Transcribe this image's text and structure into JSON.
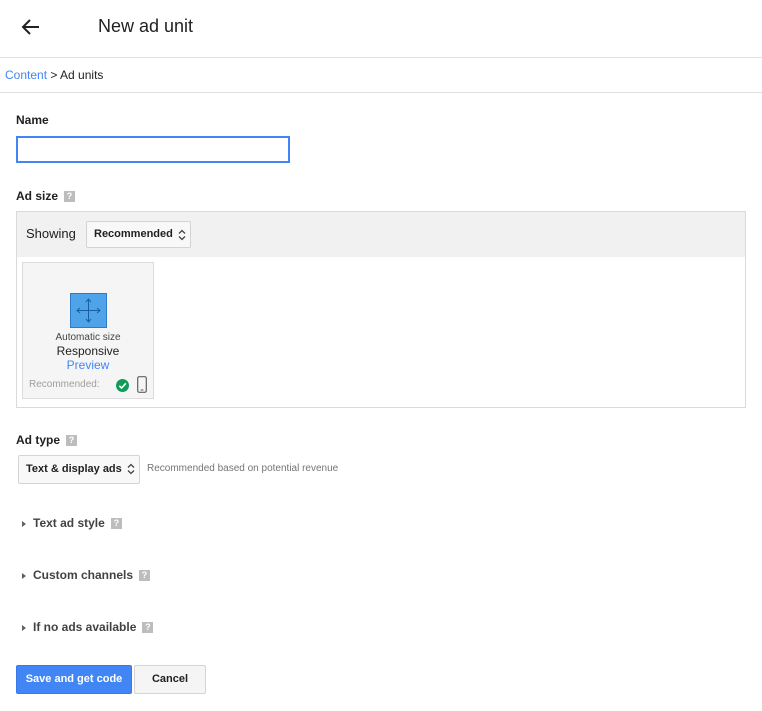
{
  "header": {
    "title": "New ad unit",
    "back_icon": "arrow-left-icon"
  },
  "breadcrumb": {
    "link": "Content",
    "separator": " > ",
    "current": "Ad units"
  },
  "name": {
    "label": "Name",
    "value": "",
    "placeholder": ""
  },
  "ad_size": {
    "label": "Ad size",
    "showing_label": "Showing",
    "showing_value": "Recommended",
    "card": {
      "caption": "Automatic size",
      "title": "Responsive",
      "preview": "Preview",
      "recommended": "Recommended:"
    }
  },
  "ad_type": {
    "label": "Ad type",
    "select_value": "Text & display ads",
    "note": "Recommended based on potential revenue"
  },
  "sections": [
    {
      "label": "Text ad style"
    },
    {
      "label": "Custom channels"
    },
    {
      "label": "If no ads available"
    }
  ],
  "help_glyph": "?",
  "actions": {
    "save": "Save and get code",
    "cancel": "Cancel"
  },
  "colors": {
    "accent": "#4285f4",
    "success": "#0f9d58",
    "icon_fill": "#4fa3e8"
  }
}
